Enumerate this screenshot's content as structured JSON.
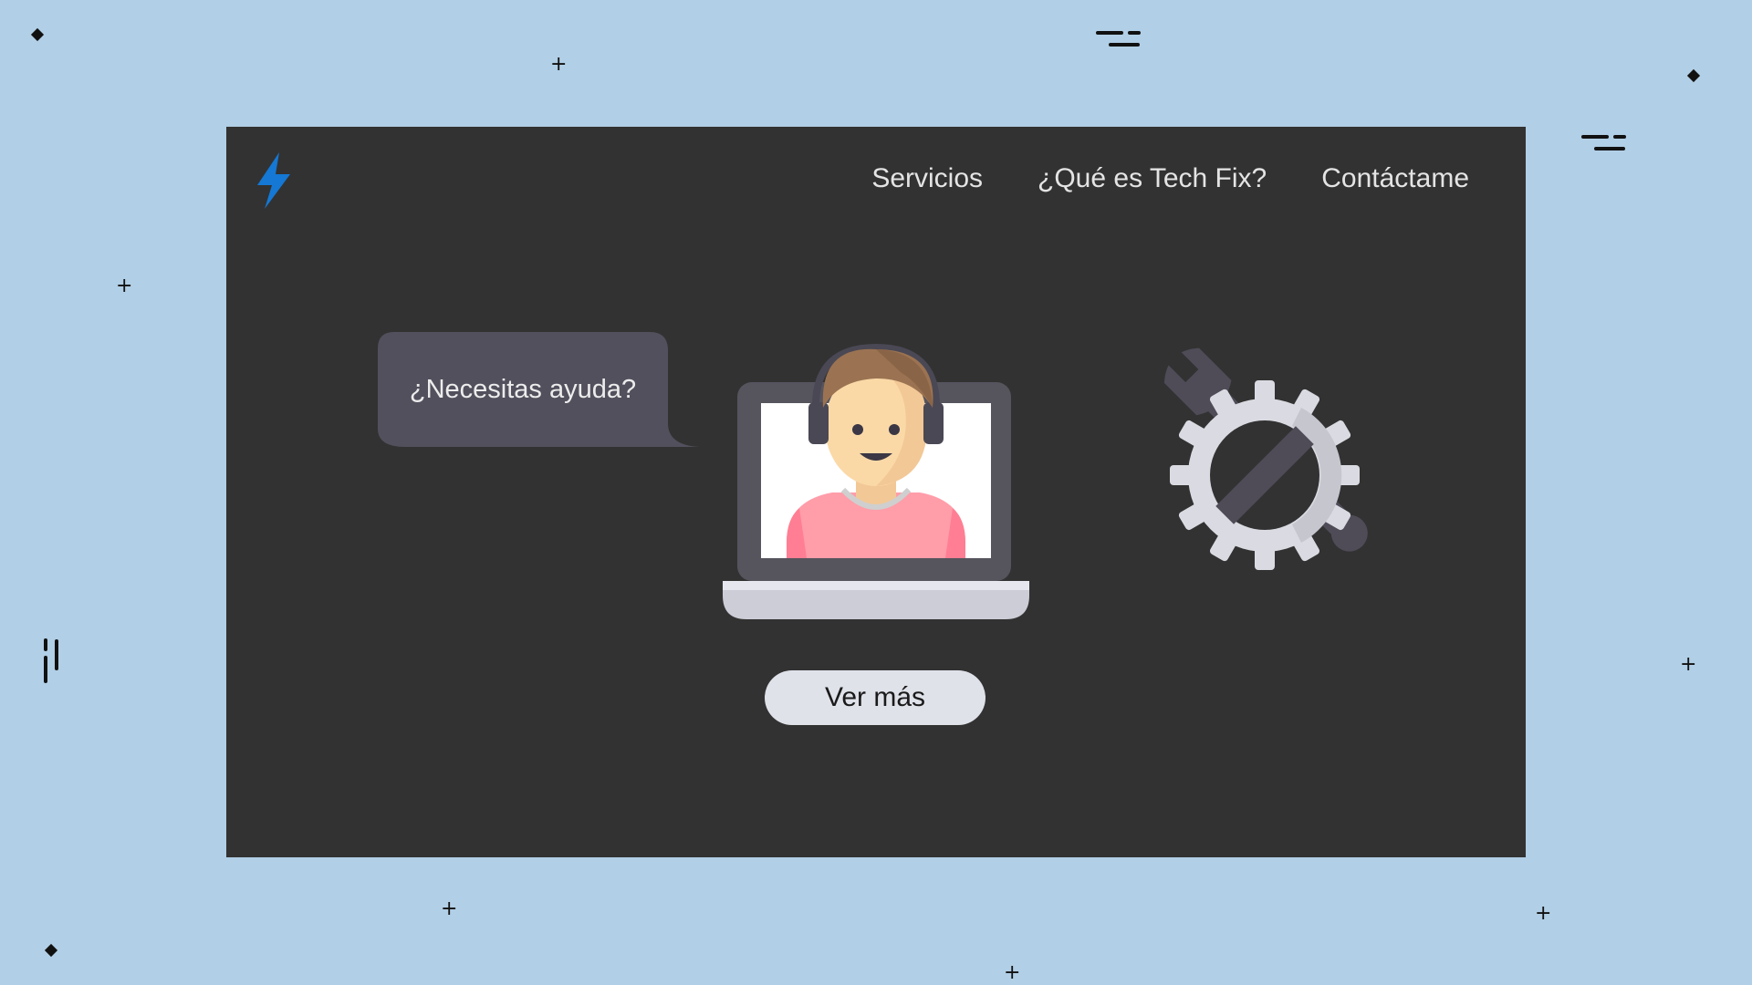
{
  "nav": {
    "items": [
      "Servicios",
      "¿Qué es Tech Fix?",
      "Contáctame"
    ]
  },
  "hero": {
    "bubble_text": "¿Necesitas ayuda?",
    "cta_label": "Ver más"
  },
  "icons": {
    "logo": "lightning-bolt-icon",
    "illustration": "support-agent-laptop",
    "tools": "gear-wrench-icon"
  },
  "colors": {
    "page_background": "#b1cfe6",
    "site_background": "#323232",
    "logo_accent": "#1478d4",
    "bubble": "#53505d",
    "button": "#e0e2ea"
  }
}
